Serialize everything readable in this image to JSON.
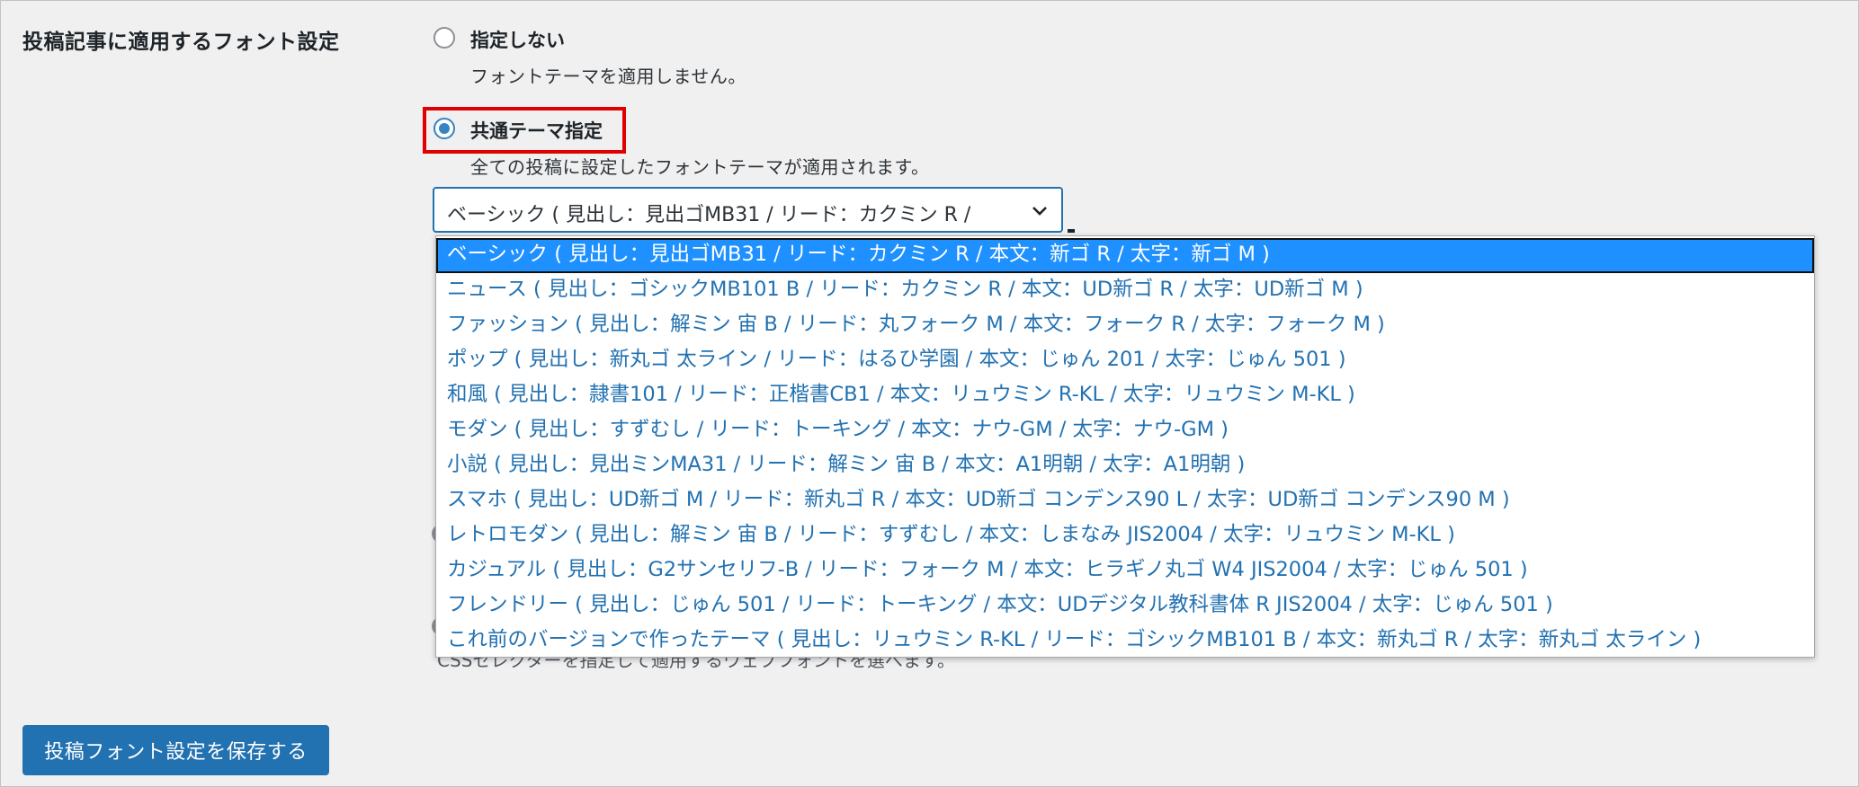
{
  "settings": {
    "section_label": "投稿記事に適用するフォント設定",
    "option_none": {
      "label": "指定しない",
      "description": "フォントテーマを適用しません。"
    },
    "option_common": {
      "label": "共通テーマ指定",
      "description": "全ての投稿に設定したフォントテーマが適用されます。",
      "selected_value": "ベーシック ( 見出し：見出ゴMB31 / リード：カクミン R /"
    },
    "option_css_description": "CSSセレクターを指定して適用するウェブフォントを選べます。",
    "theme_options": [
      "ベーシック ( 見出し：見出ゴMB31 / リード：カクミン R / 本文：新ゴ R / 太字：新ゴ M )",
      "ニュース ( 見出し：ゴシックMB101 B / リード：カクミン R / 本文：UD新ゴ R / 太字：UD新ゴ M )",
      "ファッション ( 見出し：解ミン 宙 B / リード：丸フォーク M / 本文：フォーク R / 太字：フォーク M )",
      "ポップ ( 見出し：新丸ゴ 太ライン / リード：はるひ学園 / 本文：じゅん 201 / 太字：じゅん 501 )",
      "和風 ( 見出し：隷書101 / リード：正楷書CB1 / 本文：リュウミン R-KL / 太字：リュウミン M-KL )",
      "モダン ( 見出し：すずむし / リード：トーキング / 本文：ナウ-GM / 太字：ナウ-GM )",
      "小説 ( 見出し：見出ミンMA31 / リード：解ミン 宙 B / 本文：A1明朝 / 太字：A1明朝 )",
      "スマホ ( 見出し：UD新ゴ M / リード：新丸ゴ R / 本文：UD新ゴ コンデンス90 L / 太字：UD新ゴ コンデンス90 M )",
      "レトロモダン ( 見出し：解ミン 宙 B / リード：すずむし / 本文：しまなみ JIS2004 / 太字：リュウミン M-KL )",
      "カジュアル ( 見出し：G2サンセリフ-B / リード：フォーク M / 本文：ヒラギノ丸ゴ W4 JIS2004 / 太字：じゅん 501 )",
      "フレンドリー ( 見出し：じゅん 501 / リード：トーキング / 本文：UDデジタル教科書体 R JIS2004 / 太字：じゅん 501 )",
      "これ前のバージョンで作ったテーマ ( 見出し：リュウミン R-KL / リード：ゴシックMB101 B / 本文：新丸ゴ R / 太字：新丸ゴ 太ライン )"
    ],
    "selected_index": 0,
    "save_button": "投稿フォント設定を保存する",
    "colors": {
      "primary": "#2271b1",
      "highlight_box": "#e00000",
      "option_selected_bg": "#1e90ff",
      "option_text": "#2271b1"
    }
  }
}
